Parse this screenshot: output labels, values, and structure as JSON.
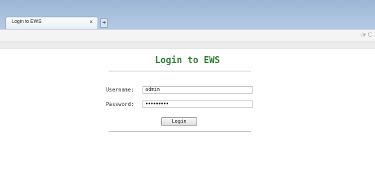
{
  "browser": {
    "tab_title": "Login to EWS",
    "tab_close": "×",
    "new_tab": "+",
    "nav_star": "☆",
    "nav_reload": "▾ C"
  },
  "page": {
    "title": "Login to EWS",
    "username_label": "Username:",
    "username_value": "admin",
    "password_label": "Password:",
    "password_value": "•••••••••",
    "login_button": "Login"
  },
  "colors": {
    "title": "#2f7a2f",
    "chrome": "#9db6d6"
  }
}
